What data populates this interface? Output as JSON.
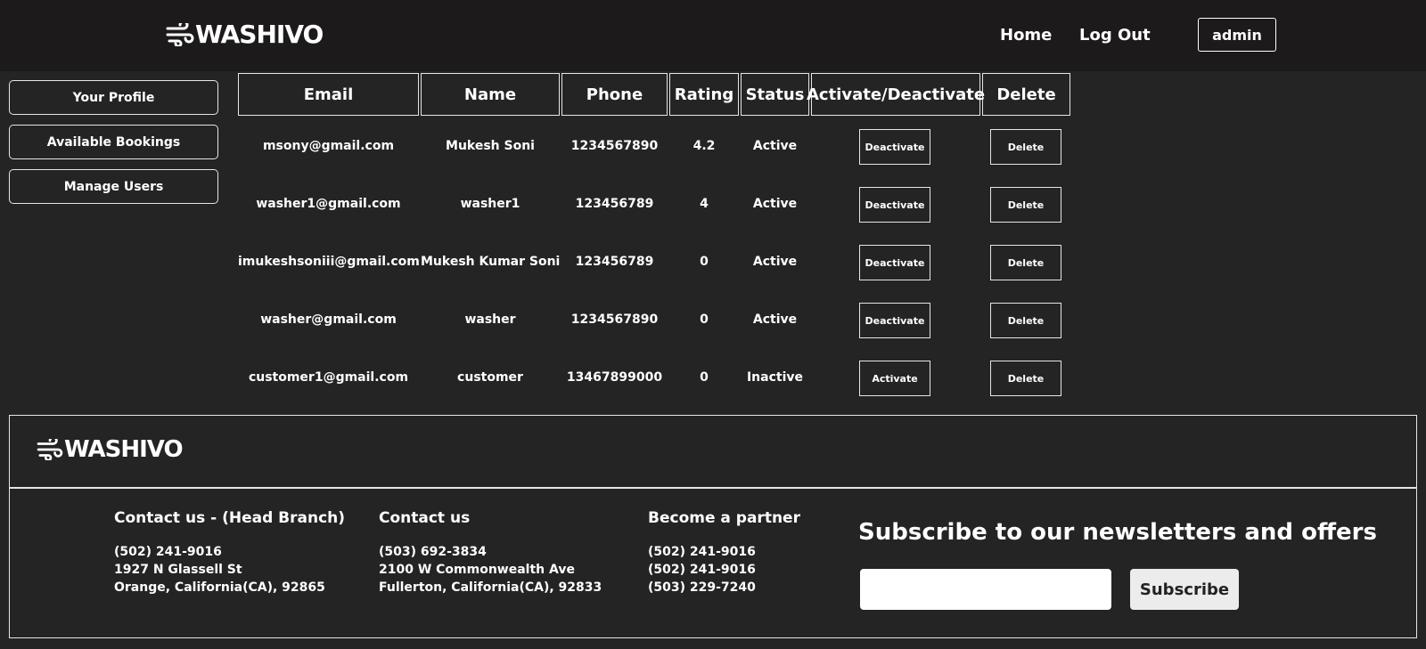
{
  "header": {
    "brand": "WASHIVO",
    "nav": {
      "home": "Home",
      "logout": "Log Out"
    },
    "user_button": "admin"
  },
  "sidebar": {
    "items": [
      {
        "label": "Your Profile"
      },
      {
        "label": "Available Bookings"
      },
      {
        "label": "Manage Users"
      }
    ]
  },
  "table": {
    "headers": [
      "Email",
      "Name",
      "Phone",
      "Rating",
      "Status",
      "Activate/Deactivate",
      "Delete"
    ],
    "rows": [
      {
        "email": "msony@gmail.com",
        "name": "Mukesh Soni",
        "phone": "1234567890",
        "rating": "4.2",
        "status": "Active",
        "toggle": "Deactivate",
        "delete": "Delete"
      },
      {
        "email": "washer1@gmail.com",
        "name": "washer1",
        "phone": "123456789",
        "rating": "4",
        "status": "Active",
        "toggle": "Deactivate",
        "delete": "Delete"
      },
      {
        "email": "imukeshsoniii@gmail.com",
        "name": "Mukesh Kumar Soni",
        "phone": "123456789",
        "rating": "0",
        "status": "Active",
        "toggle": "Deactivate",
        "delete": "Delete"
      },
      {
        "email": "washer@gmail.com",
        "name": "washer",
        "phone": "1234567890",
        "rating": "0",
        "status": "Active",
        "toggle": "Deactivate",
        "delete": "Delete"
      },
      {
        "email": "customer1@gmail.com",
        "name": "customer",
        "phone": "13467899000",
        "rating": "0",
        "status": "Inactive",
        "toggle": "Activate",
        "delete": "Delete"
      }
    ]
  },
  "footer": {
    "brand": "WASHIVO",
    "columns": [
      {
        "title": "Contact us - (Head Branch)",
        "lines": [
          "(502) 241-9016",
          "1927 N Glassell St",
          "Orange, California(CA), 92865"
        ]
      },
      {
        "title": "Contact us",
        "lines": [
          "(503) 692-3834",
          "2100 W Commonwealth Ave",
          "Fullerton, California(CA), 92833"
        ]
      },
      {
        "title": "Become a partner",
        "lines": [
          "(502) 241-9016",
          "(502) 241-9016",
          "(503) 229-7240"
        ]
      }
    ],
    "subscribe": {
      "title": "Subscribe to our newsletters and offers",
      "input_value": "",
      "button": "Subscribe"
    }
  },
  "icons": {
    "logo": "wind-icon"
  },
  "colors": {
    "background": "#242424",
    "header": "#1c1a1a",
    "border": "#e6e6e6",
    "button_light": "#ececec"
  }
}
